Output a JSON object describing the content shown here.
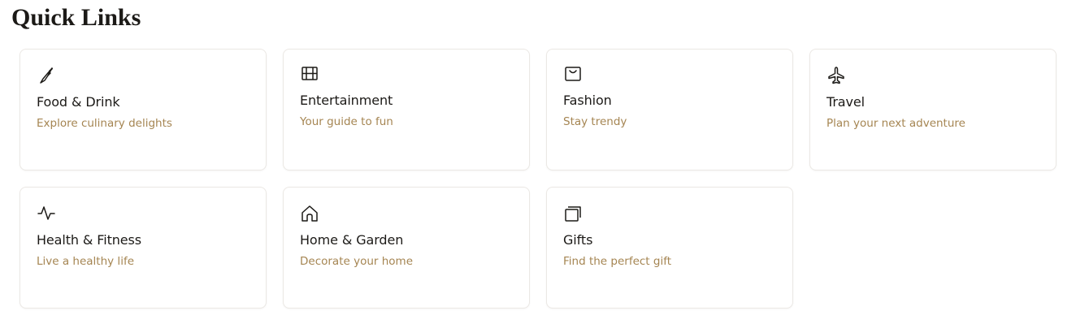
{
  "page": {
    "title": "Quick Links",
    "accent_color": "#a58552",
    "text_color": "#1c1a17",
    "border_color": "#ebe8e4"
  },
  "links": [
    {
      "title": "Food & Drink",
      "description": "Explore culinary delights",
      "icon": "knife-icon"
    },
    {
      "title": "Entertainment",
      "description": "Your guide to fun",
      "icon": "film-icon"
    },
    {
      "title": "Fashion",
      "description": "Stay trendy",
      "icon": "shopping-bag-icon"
    },
    {
      "title": "Travel",
      "description": "Plan your next adventure",
      "icon": "airplane-icon"
    },
    {
      "title": "Health & Fitness",
      "description": "Live a healthy life",
      "icon": "activity-icon"
    },
    {
      "title": "Home & Garden",
      "description": "Decorate your home",
      "icon": "home-icon"
    },
    {
      "title": "Gifts",
      "description": "Find the perfect gift",
      "icon": "gift-cards-icon"
    }
  ]
}
